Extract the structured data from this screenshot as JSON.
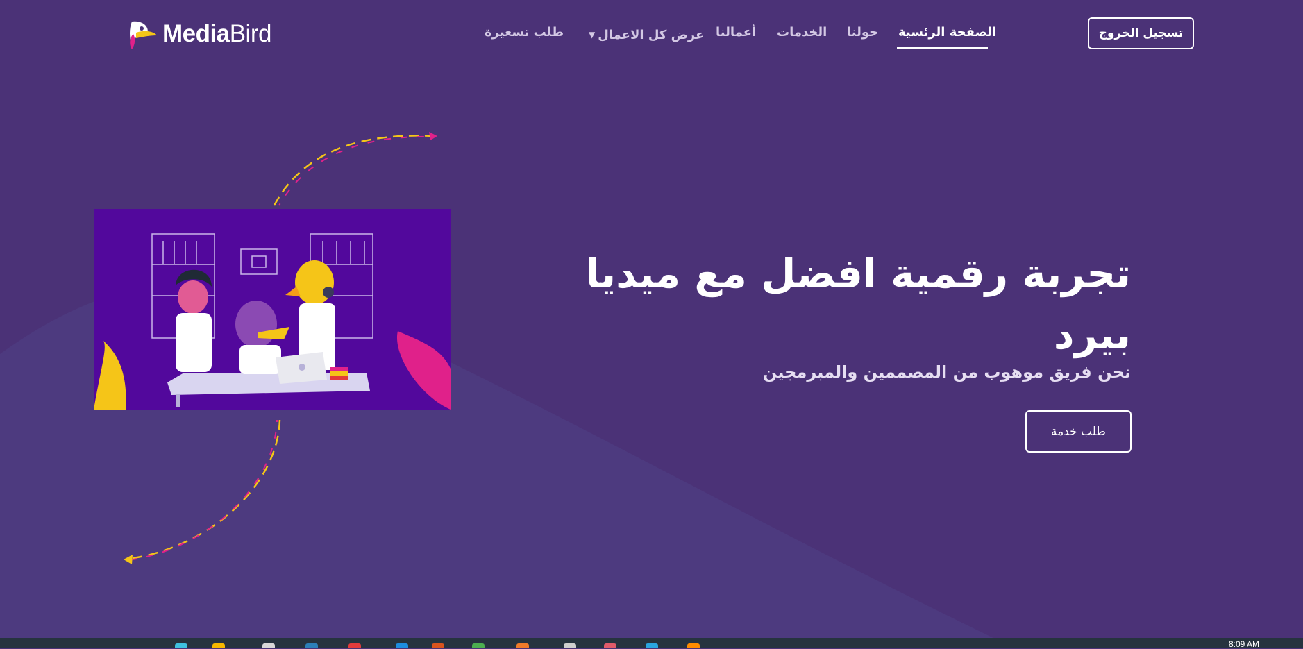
{
  "brand": {
    "name_bold": "Media",
    "name_light": "Bird"
  },
  "nav": {
    "home": "الصفحة الرئسية",
    "about": "حولنا",
    "services": "الخدمات",
    "works": "أعمالنا",
    "all_works": "عرض كل الاعمال",
    "price_request": "طلب تسعيرة"
  },
  "logout_label": "تسجيل الخروج",
  "hero": {
    "title_line1": "تجربة رقمية افضل مع ميديا",
    "title_line2": "بيرد",
    "subtitle": "نحن فريق موهوب من المصممين والمبرمجين",
    "cta_label": "طلب خدمة"
  },
  "taskbar": {
    "clock": "8:09 AM"
  },
  "colors": {
    "background": "#4b3277",
    "wave": "#4d3a7f",
    "image_bg": "#52089c",
    "accent_yellow": "#f5c518",
    "accent_pink": "#e0218a"
  }
}
